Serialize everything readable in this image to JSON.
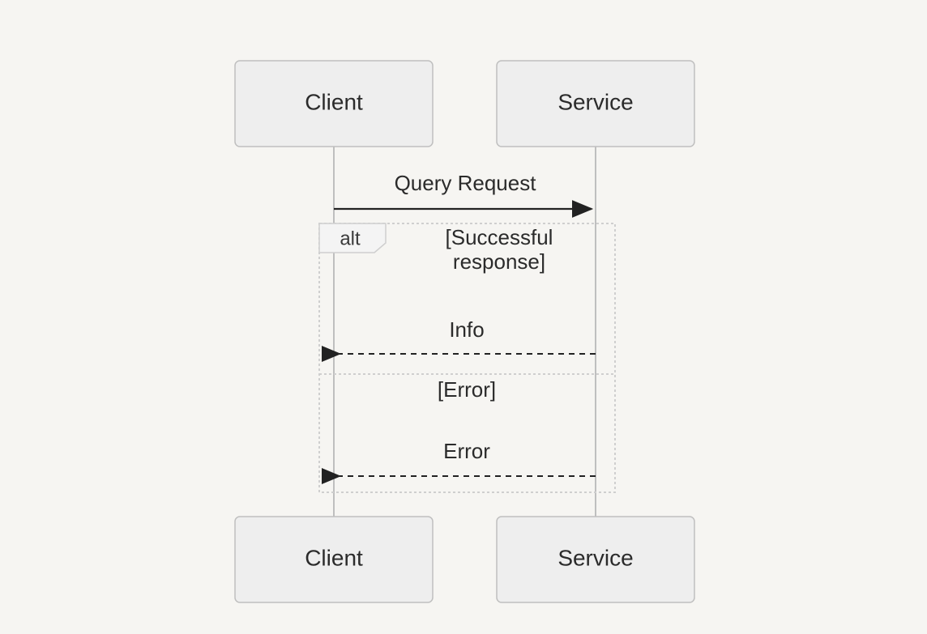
{
  "participants": {
    "client": "Client",
    "service": "Service"
  },
  "messages": {
    "request": "Query Request",
    "info": "Info",
    "error": "Error"
  },
  "alt": {
    "label": "alt",
    "cond1_line1": "[Successful",
    "cond1_line2": "response]",
    "cond2": "[Error]"
  }
}
